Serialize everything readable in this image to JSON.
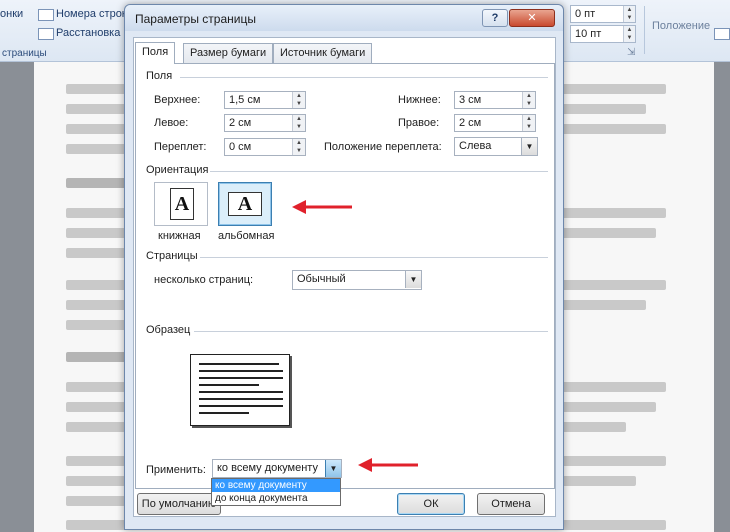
{
  "ribbon": {
    "left_partial": "онки",
    "line_numbers": "Номера строк",
    "hyphenation": "Расстановка п",
    "group_label": "страницы",
    "spacing_before": "0 пт",
    "spacing_after": "10 пт",
    "position_label": "Положение"
  },
  "dialog": {
    "title": "Параметры страницы",
    "help": "?",
    "close": "✕",
    "tabs": [
      "Поля",
      "Размер бумаги",
      "Источник бумаги"
    ],
    "margins": {
      "section": "Поля",
      "top_label": "Верхнее:",
      "top_value": "1,5 см",
      "bottom_label": "Нижнее:",
      "bottom_value": "3 см",
      "left_label": "Левое:",
      "left_value": "2 см",
      "right_label": "Правое:",
      "right_value": "2 см",
      "gutter_label": "Переплет:",
      "gutter_value": "0 см",
      "gutter_pos_label": "Положение переплета:",
      "gutter_pos_value": "Слева"
    },
    "orientation": {
      "section": "Ориентация",
      "portrait": "книжная",
      "landscape": "альбомная",
      "glyph": "A",
      "selected": "landscape"
    },
    "pages": {
      "section": "Страницы",
      "multiple_label": "несколько страниц:",
      "multiple_value": "Обычный"
    },
    "preview": {
      "section": "Образец"
    },
    "apply": {
      "label": "Применить:",
      "value": "ко всему документу",
      "options": [
        "ко всему документу",
        "до конца документа"
      ]
    },
    "buttons": {
      "default": "По умолчанию",
      "ok": "ОК",
      "cancel": "Отмена"
    }
  },
  "colors": {
    "annotation_arrow": "#e0212b",
    "selection": "#3399ff",
    "close_button": "#c94a2f"
  }
}
